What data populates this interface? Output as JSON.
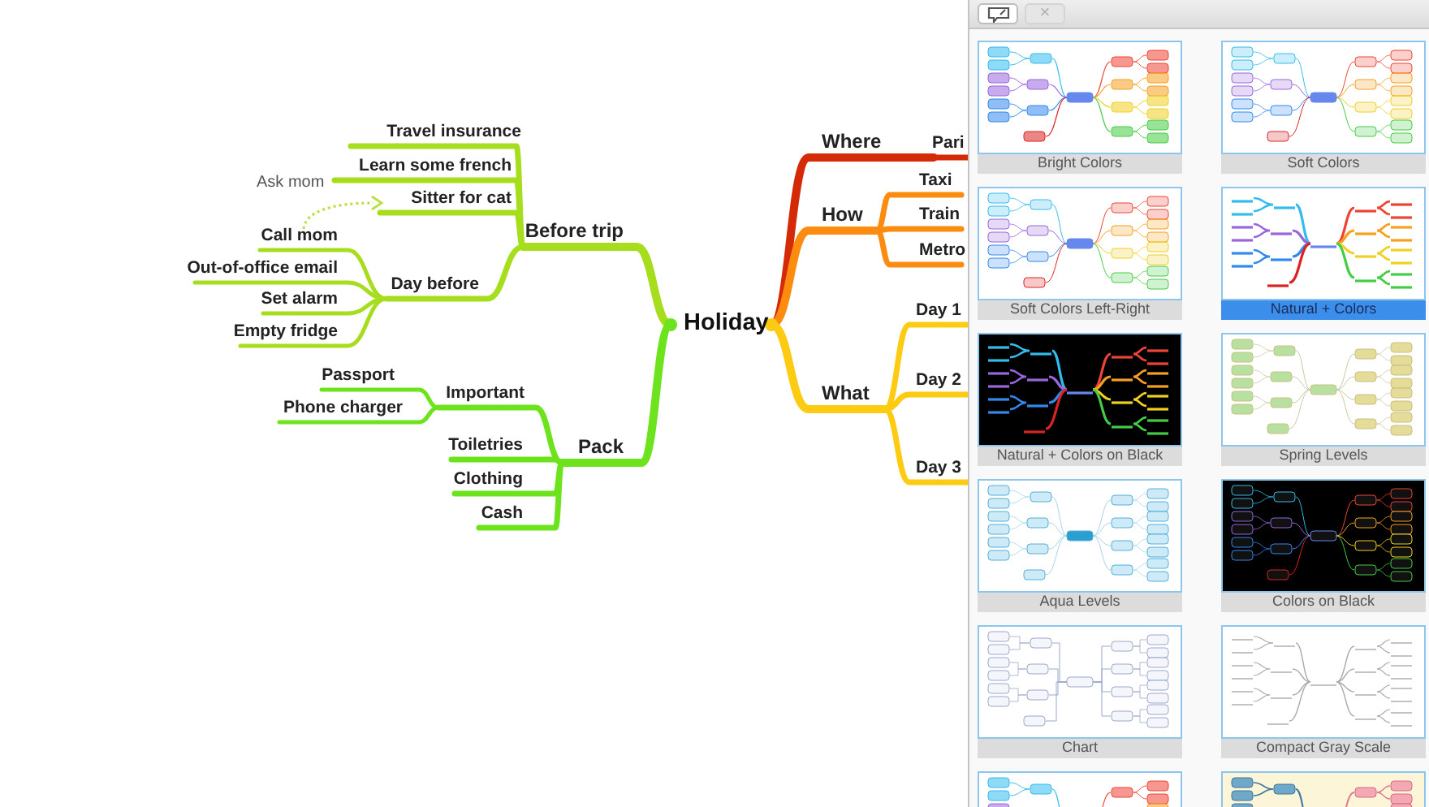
{
  "mindmap": {
    "central_topic": "Holiday",
    "callout": {
      "text": "Ask mom"
    },
    "branches": [
      {
        "label": "Before trip",
        "color": "#a6de1e",
        "children": [
          {
            "label": "Travel insurance"
          },
          {
            "label": "Learn some french"
          },
          {
            "label": "Sitter for cat"
          },
          {
            "label": "Day before",
            "children": [
              {
                "label": "Call mom"
              },
              {
                "label": "Out-of-office email"
              },
              {
                "label": "Set alarm"
              },
              {
                "label": "Empty fridge"
              }
            ]
          }
        ]
      },
      {
        "label": "Pack",
        "color": "#6ce31c",
        "children": [
          {
            "label": "Important",
            "children": [
              {
                "label": "Passport"
              },
              {
                "label": "Phone charger"
              }
            ]
          },
          {
            "label": "Toiletries"
          },
          {
            "label": "Clothing"
          },
          {
            "label": "Cash"
          }
        ]
      },
      {
        "label": "Where",
        "color": "#d42a08",
        "children": [
          {
            "label": "Pari"
          }
        ]
      },
      {
        "label": "How",
        "color": "#fb8c10",
        "children": [
          {
            "label": "Taxi"
          },
          {
            "label": "Train"
          },
          {
            "label": "Metro"
          }
        ]
      },
      {
        "label": "What",
        "color": "#fccb12",
        "children": [
          {
            "label": "Day 1"
          },
          {
            "label": "Day 2"
          },
          {
            "label": "Day 3"
          }
        ]
      }
    ]
  },
  "theme_panel": {
    "toolbar": [
      {
        "kind": "icon",
        "disabled": false
      },
      {
        "kind": "text",
        "label": "×",
        "disabled": true
      }
    ],
    "themes": [
      {
        "name": "Bright Colors",
        "kind": "bright",
        "selected": false
      },
      {
        "name": "Soft Colors",
        "kind": "soft",
        "selected": false
      },
      {
        "name": "Soft Colors Left-Right",
        "kind": "soft",
        "selected": false
      },
      {
        "name": "Natural + Colors",
        "kind": "natural",
        "selected": true
      },
      {
        "name": "Natural + Colors on Black",
        "kind": "naturalblack",
        "selected": false
      },
      {
        "name": "Spring Levels",
        "kind": "spring",
        "selected": false
      },
      {
        "name": "Aqua Levels",
        "kind": "aqua",
        "selected": false
      },
      {
        "name": "Colors on Black",
        "kind": "colorsblack",
        "selected": false
      },
      {
        "name": "Chart",
        "kind": "chart",
        "selected": false
      },
      {
        "name": "Compact Gray Scale",
        "kind": "gray",
        "selected": false
      }
    ],
    "partial_previews": [
      {
        "kind": "bright"
      },
      {
        "kind": "cream"
      }
    ]
  }
}
